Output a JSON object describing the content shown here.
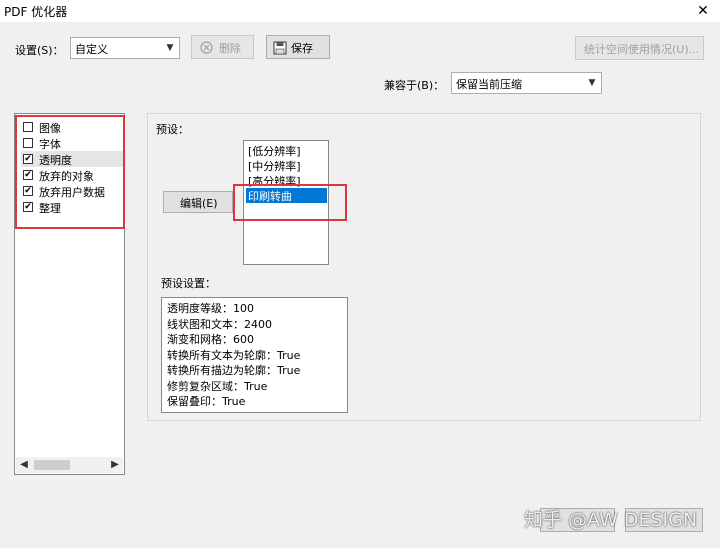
{
  "window": {
    "title": "PDF 优化器",
    "close_icon": "✕"
  },
  "toolbar": {
    "settings_label": "设置(S)：",
    "settings_value": "自定义",
    "delete_label": "删除",
    "save_label": "保存",
    "stats_label": "统计空间使用情况(U)..."
  },
  "compat": {
    "label": "兼容于(B)：",
    "value": "保留当前压缩"
  },
  "sidebar": {
    "items": [
      {
        "label": "图像",
        "checked": false
      },
      {
        "label": "字体",
        "checked": false
      },
      {
        "label": "透明度",
        "checked": true
      },
      {
        "label": "放弃的对象",
        "checked": true
      },
      {
        "label": "放弃用户数据",
        "checked": true
      },
      {
        "label": "整理",
        "checked": true
      }
    ],
    "check_mark": "✔"
  },
  "presets": {
    "label": "预设：",
    "edit_button": "编辑(E)",
    "items": [
      "[低分辨率]",
      "[中分辨率]",
      "[高分辨率]",
      "印刷转曲"
    ],
    "selected": "印刷转曲"
  },
  "preset_settings": {
    "label": "预设设置：",
    "lines": [
      "透明度等级：100",
      "线状图和文本：2400",
      "渐变和网格：600",
      "转换所有文本为轮廓：True",
      "转换所有描边为轮廓：True",
      "修剪复杂区域：True",
      "保留叠印：True"
    ]
  },
  "footer": {
    "watermark": "知乎 @AW DESIGN"
  },
  "colors": {
    "highlight": "#d9363e",
    "selection": "#0078d7"
  }
}
